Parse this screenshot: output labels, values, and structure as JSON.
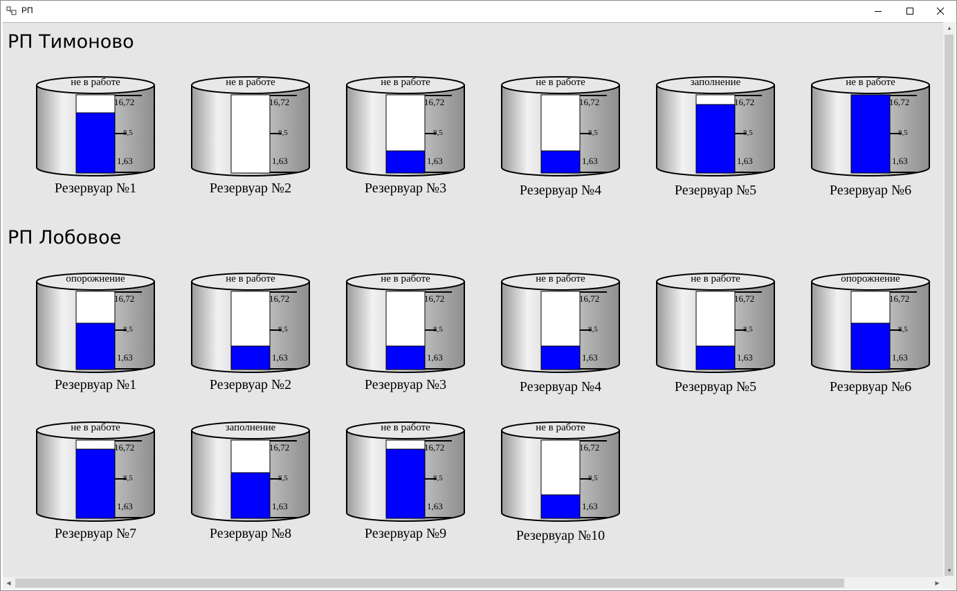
{
  "window": {
    "title": "РП"
  },
  "scale": {
    "top": "16,72",
    "mid": "8,5",
    "bottom": "1,63",
    "max": 16.72,
    "min": 0
  },
  "colors": {
    "water": "#0000ff",
    "empty": "#ffffff",
    "background": "#e6e6e6"
  },
  "stations": [
    {
      "title": "РП Тимоново",
      "tanks": [
        {
          "label": "Резервуар №1",
          "status": "не в работе",
          "level": 12.9
        },
        {
          "label": "Резервуар №2",
          "status": "не в работе",
          "level": 0
        },
        {
          "label": "Резервуар №3",
          "status": "не в работе",
          "level": 4.8
        },
        {
          "label": "Резервуар №4",
          "status": "не в работе",
          "level": 4.8
        },
        {
          "label": "Резервуар №5",
          "status": "заполнение",
          "level": 14.7
        },
        {
          "label": "Резервуар №6",
          "status": "не в работе",
          "level": 16.72
        }
      ]
    },
    {
      "title": "РП Лобовое",
      "tanks": [
        {
          "label": "Резервуар №1",
          "status": "опорожнение",
          "level": 9.9
        },
        {
          "label": "Резервуар №2",
          "status": "не в работе",
          "level": 5.0
        },
        {
          "label": "Резервуар №3",
          "status": "не в работе",
          "level": 5.0
        },
        {
          "label": "Резервуар №4",
          "status": "не в работе",
          "level": 5.0
        },
        {
          "label": "Резервуар №5",
          "status": "не в работе",
          "level": 5.0
        },
        {
          "label": "Резервуар №6",
          "status": "опорожнение",
          "level": 9.9
        },
        {
          "label": "Резервуар №7",
          "status": "не в работе",
          "level": 14.8
        },
        {
          "label": "Резервуар №8",
          "status": "заполнение",
          "level": 9.7
        },
        {
          "label": "Резервуар №9",
          "status": "не в работе",
          "level": 14.8
        },
        {
          "label": "Резервуар №10",
          "status": "не в работе",
          "level": 5.0
        }
      ]
    }
  ]
}
